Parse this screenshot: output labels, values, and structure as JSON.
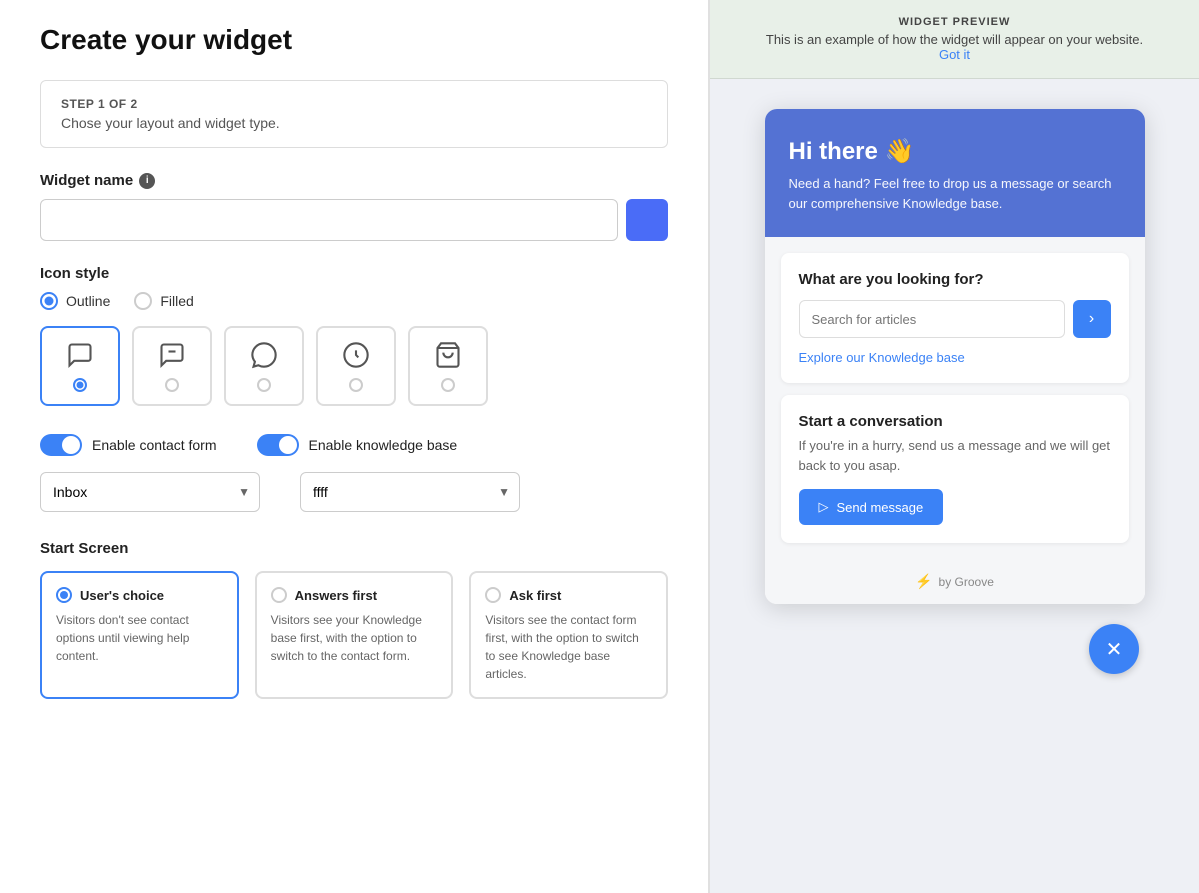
{
  "page": {
    "title": "Create your widget"
  },
  "left": {
    "step": {
      "label": "STEP 1 OF 2",
      "description": "Chose your layout and widget type."
    },
    "widget_name": {
      "label": "Widget name",
      "info_icon": "i",
      "input_placeholder": "",
      "input_value": ""
    },
    "icon_style": {
      "label": "Icon style",
      "options": [
        {
          "id": "outline",
          "label": "Outline",
          "selected": true
        },
        {
          "id": "filled",
          "label": "Filled",
          "selected": false
        }
      ]
    },
    "icons": [
      {
        "id": "icon-chat",
        "selected": true
      },
      {
        "id": "icon-chat2",
        "selected": false
      },
      {
        "id": "icon-bubble",
        "selected": false
      },
      {
        "id": "icon-support",
        "selected": false
      },
      {
        "id": "icon-bag",
        "selected": false
      }
    ],
    "toggles": [
      {
        "id": "enable-contact-form",
        "label": "Enable contact form",
        "enabled": true
      },
      {
        "id": "enable-knowledge-base",
        "label": "Enable knowledge base",
        "enabled": true
      }
    ],
    "dropdowns": [
      {
        "id": "inbox-dropdown",
        "value": "Inbox",
        "options": [
          "Inbox"
        ]
      },
      {
        "id": "ffff-dropdown",
        "value": "ffff",
        "options": [
          "ffff"
        ]
      }
    ],
    "start_screen": {
      "label": "Start Screen",
      "options": [
        {
          "id": "users-choice",
          "title": "User's choice",
          "description": "Visitors don't see contact options until viewing help content.",
          "selected": true
        },
        {
          "id": "answers-first",
          "title": "Answers first",
          "description": "Visitors see your Knowledge base first, with the option to switch to the contact form.",
          "selected": false
        },
        {
          "id": "ask-first",
          "title": "Ask first",
          "description": "Visitors see the contact form first, with the option to switch to see Knowledge base articles.",
          "selected": false
        }
      ]
    }
  },
  "right": {
    "preview": {
      "title": "WIDGET PREVIEW",
      "description": "This is an example of how the widget will appear on your website.",
      "link_text": "Got it"
    },
    "widget": {
      "greeting": "Hi there 👋",
      "subtext": "Need a hand? Feel free to drop us a message or search our comprehensive Knowledge base.",
      "knowledge_card": {
        "title": "What are you looking for?",
        "search_placeholder": "Search for articles",
        "explore_link": "Explore our Knowledge base"
      },
      "conversation_card": {
        "title": "Start a conversation",
        "description": "If you're in a hurry, send us a message and we will get back to you asap.",
        "button_label": "Send message"
      },
      "footer": "by Groove"
    },
    "close_button": "✕"
  }
}
